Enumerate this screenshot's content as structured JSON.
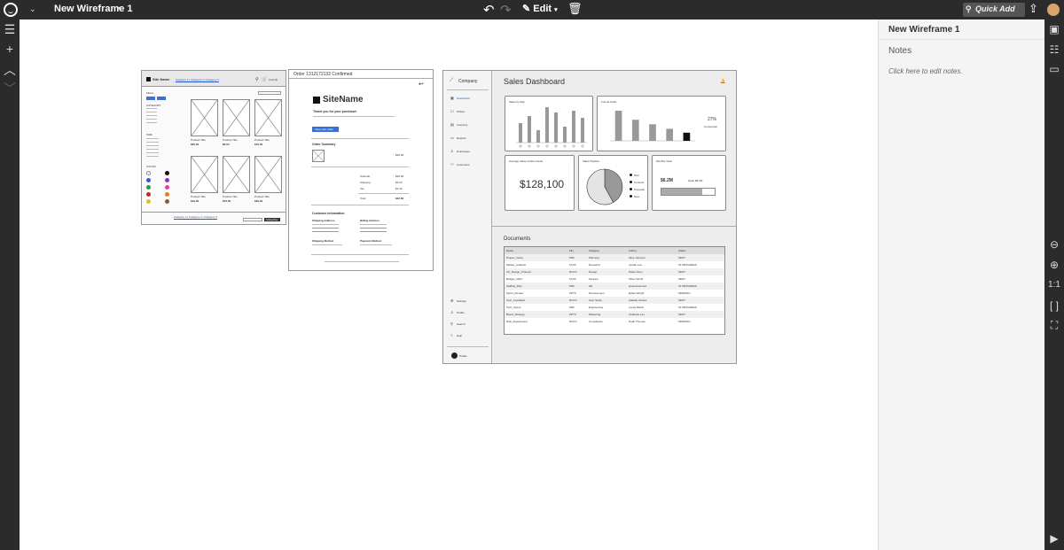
{
  "app": {
    "title": "New Wireframe 1",
    "edit_label": "Edit",
    "quick_add": "Quick Add"
  },
  "panel": {
    "title": "New Wireframe 1",
    "notes_label": "Notes",
    "notes_placeholder": "Click here to edit notes."
  },
  "zoom_controls": [
    "1:1"
  ],
  "wf_store": {
    "site_name": "Site Name",
    "breadcrumb": "Category 1 | Category 2 | Category 3",
    "cart": "Cart (3)",
    "filters": "Filters",
    "category_label": "CATEGORY",
    "size_label": "SIZE",
    "color_label": "COLOR",
    "product_title": "Product Title",
    "prices": [
      "$20.00",
      "$6.00",
      "$79.00",
      "$19.00",
      "$70.00",
      "$49.00"
    ],
    "footer_links": "Category 1 | Category 2 | Category 3",
    "subscribe": "Subscribe"
  },
  "wf_order": {
    "header": "Order 1312172132 Confirmed",
    "site_name": "SiteName",
    "thanks": "Thank you for your purchase!",
    "view_order": "View your order",
    "summary": "Order Summary",
    "item_price": "$20.00",
    "subtotal_label": "Subtotal",
    "subtotal": "$20.00",
    "shipping_label": "Shipping",
    "shipping": "$2.20",
    "tax_label": "Tax",
    "tax": "$1.40",
    "total_label": "Total",
    "total": "$23.60",
    "customer_info": "Customer Information",
    "shipping_address": "Shipping Address",
    "billing_address": "Billing Address",
    "shipping_method": "Shipping Method",
    "payment_method": "Payment Method"
  },
  "wf_dash": {
    "company": "Company",
    "nav": [
      "Dashboard",
      "Orders",
      "Inventory",
      "Reports",
      "Employees",
      "Customers"
    ],
    "nav_bottom": [
      "Settings",
      "Profile",
      "Search",
      "Help"
    ],
    "profile": "Profile",
    "title": "Sales Dashboard",
    "card1_title": "Sales by Rep",
    "card2_title": "Funnel Chart",
    "funnel_pct": "27%",
    "funnel_pct_label": "Conversion",
    "card3_title": "Average Value of Won Deals",
    "won_value": "$128,100",
    "card4_title": "Sales Pipeline",
    "pipeline_legend": [
      "Won",
      "Contract",
      "Proposal",
      "New"
    ],
    "card5_title": "Monthly Goal",
    "goal_current": "$6.2M",
    "goal_target": "Goal: $8.1M",
    "documents_title": "Documents",
    "doc_headers": [
      "Name",
      "File",
      "Category",
      "Author",
      "Status"
    ],
    "doc_rows": [
      [
        "Project_Vision",
        "PDF",
        "Planning",
        "Alice Johnson",
        "SENT"
      ],
      [
        "Market_Analysis",
        "XLSX",
        "Research",
        "Jordan Lee",
        "IN PROGRESS"
      ],
      [
        "UX_Design_Protocol",
        "DOCX",
        "Design",
        "Parks Chen",
        "SENT"
      ],
      [
        "Budget_2024",
        "XLSX",
        "Finance",
        "Oliver Smith",
        "SENT"
      ],
      [
        "Staffing_Plan",
        "PDF",
        "HR",
        "Hannah Arnold",
        "IN PROGRESS"
      ],
      [
        "Sprint_Review",
        "PPTX",
        "Development",
        "Ethan Wright",
        "PENDING"
      ],
      [
        "User_Feedback",
        "DOCX",
        "User Study",
        "Isabelle Santos",
        "SENT"
      ],
      [
        "Tech_Specs",
        "PDF",
        "Engineering",
        "Lucas Martin",
        "IN PROGRESS"
      ],
      [
        "Brand_Strategy",
        "PPTX",
        "Marketing",
        "Charlotte Lee",
        "SENT"
      ],
      [
        "Risk_Assessment",
        "DOCX",
        "Compliance",
        "Noah Thomas",
        "PENDING"
      ]
    ]
  },
  "chart_data": [
    {
      "type": "bar",
      "title": "Sales by Rep",
      "categories": [
        "",
        "",
        "",
        "",
        "",
        "",
        "",
        ""
      ],
      "values": [
        55,
        75,
        35,
        100,
        85,
        45,
        90,
        70
      ],
      "ylim": [
        0,
        100
      ]
    },
    {
      "type": "bar",
      "title": "Funnel Chart",
      "categories": [
        "",
        "",
        "",
        "",
        ""
      ],
      "values": [
        100,
        70,
        55,
        40,
        27
      ],
      "ylim": [
        0,
        100
      ]
    },
    {
      "type": "pie",
      "title": "Sales Pipeline",
      "labels": [
        "Won",
        "Contract",
        "Proposal",
        "New"
      ],
      "values": [
        42,
        58
      ]
    }
  ]
}
